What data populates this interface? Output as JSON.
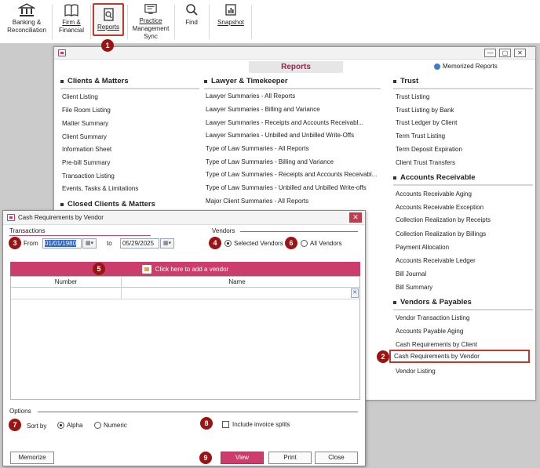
{
  "ribbon": {
    "buttons": [
      {
        "label_a": "Banking &",
        "label_b": "Reconciliation",
        "icon": "bank-icon"
      },
      {
        "label_a": "Firm &",
        "label_b": "Financial",
        "icon": "book-icon"
      },
      {
        "label_a": "Reports",
        "label_b": "",
        "icon": "report-icon"
      },
      {
        "label_a": "Practice",
        "label_b": "Management",
        "label_c": "Sync",
        "icon": "sync-icon"
      },
      {
        "label_a": "Find",
        "label_b": "",
        "icon": "magnifier-icon"
      },
      {
        "label_a": "Snapshot",
        "label_b": "",
        "icon": "snapshot-icon"
      }
    ]
  },
  "reports_window": {
    "header": "Reports",
    "memorized_link": "Memorized Reports",
    "columns": {
      "clients": {
        "title": "Clients & Matters",
        "items": [
          "Client Listing",
          "File Room Listing",
          "Matter Summary",
          "Client Summary",
          "Information Sheet",
          "Pre-bill Summary",
          "Transaction Listing",
          "Events, Tasks & Limitations"
        ]
      },
      "closed": {
        "title": "Closed Clients & Matters"
      },
      "lawyer": {
        "title": "Lawyer & Timekeeper",
        "items": [
          "Lawyer Summaries - All Reports",
          "Lawyer Summaries - Billing and Variance",
          "Lawyer Summaries - Receipts and Accounts Receivabl...",
          "Lawyer Summaries - Unbilled and Unbilled Write-Offs",
          "Type of Law Summaries - All Reports",
          "Type of Law Summaries - Billing and Variance",
          "Type of Law Summaries - Receipts and Accounts Receivabl...",
          "Type of Law Summaries - Unbilled and Unbilled Write-offs",
          "Major Client Summaries - All Reports"
        ]
      },
      "trust": {
        "title": "Trust",
        "items": [
          "Trust Listing",
          "Trust Listing by Bank",
          "Trust Ledger by Client",
          "Term Trust Listing",
          "Term Deposit Expiration",
          "Client Trust Transfers"
        ]
      },
      "ar": {
        "title": "Accounts Receivable",
        "items": [
          "Accounts Receivable Aging",
          "Accounts Receivable Exception",
          "Collection Realization by Receipts",
          "Collection Realization by Billings",
          "Payment Allocation",
          "Accounts Receivable Ledger",
          "Bill Journal",
          "Bill Summary"
        ]
      },
      "vendors": {
        "title": "Vendors & Payables",
        "items": [
          "Vendor Transaction Listing",
          "Accounts Payable Aging",
          "Cash Requirements by Client",
          "Cash Requirements by Vendor",
          "Vendor Listing"
        ]
      }
    }
  },
  "dialog": {
    "title": "Cash Requirements by Vendor",
    "transactions_label": "Transactions",
    "from_label": "From",
    "from_value": "01/01/1980",
    "to_label": "to",
    "to_value": "05/29/2025",
    "vendors_label": "Vendors",
    "selected_vendors": "Selected Vendors",
    "all_vendors": "All Vendors",
    "add_vendor": "Click here to add a vendor",
    "grid_headers": [
      "Number",
      "Name"
    ],
    "options_label": "Options",
    "sort_by": "Sort by",
    "alpha": "Alpha",
    "numeric": "Numeric",
    "include_splits": "Include invoice splits",
    "memorize": "Memorize",
    "view": "View",
    "print": "Print",
    "close": "Close"
  },
  "badges": [
    "1",
    "2",
    "3",
    "4",
    "5",
    "6",
    "7",
    "8",
    "9"
  ],
  "colors": {
    "accent": "#cc3d6b",
    "badge": "#9b1414",
    "highlight": "#c0392b"
  }
}
